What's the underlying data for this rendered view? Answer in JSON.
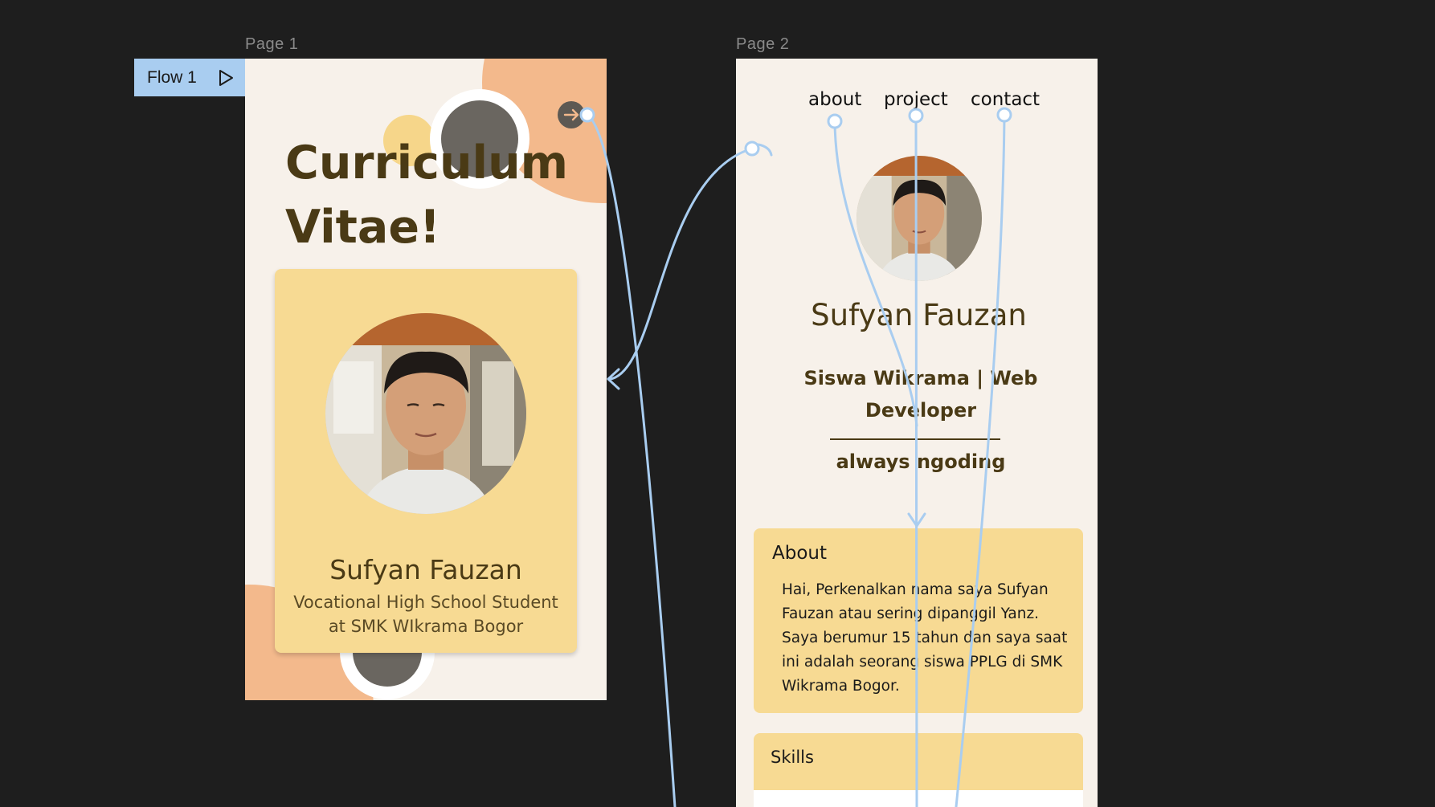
{
  "canvas": {
    "frame1_label": "Page 1",
    "frame2_label": "Page 2",
    "flow_label": "Flow 1"
  },
  "page1": {
    "title": "Curriculum Vitae!",
    "card": {
      "name": "Sufyan Fauzan",
      "subtitle": "Vocational High School Student at SMK WIkrama Bogor"
    }
  },
  "page2": {
    "nav": [
      "about",
      "project",
      "contact"
    ],
    "name": "Sufyan Fauzan",
    "role": "Siswa Wikrama | Web Developer",
    "tagline": "always ngoding",
    "about": {
      "title": "About",
      "text": "Hai, Perkenalkan nama saya Sufyan Fauzan atau sering dipanggil Yanz. Saya berumur 15 tahun dan saya saat ini adalah seorang siswa PPLG di SMK Wikrama Bogor."
    },
    "skills": {
      "title": "Skills"
    }
  },
  "colors": {
    "canvas_bg": "#1e1e1e",
    "page_bg": "#f7f1ea",
    "card_bg": "#f7da93",
    "accent_orange": "#f3b98c",
    "text_brown": "#4a3a15",
    "connector_blue": "#a9cdf0"
  },
  "icons": {
    "flow_play": "play-icon",
    "next_arrow": "arrow-right-icon"
  }
}
